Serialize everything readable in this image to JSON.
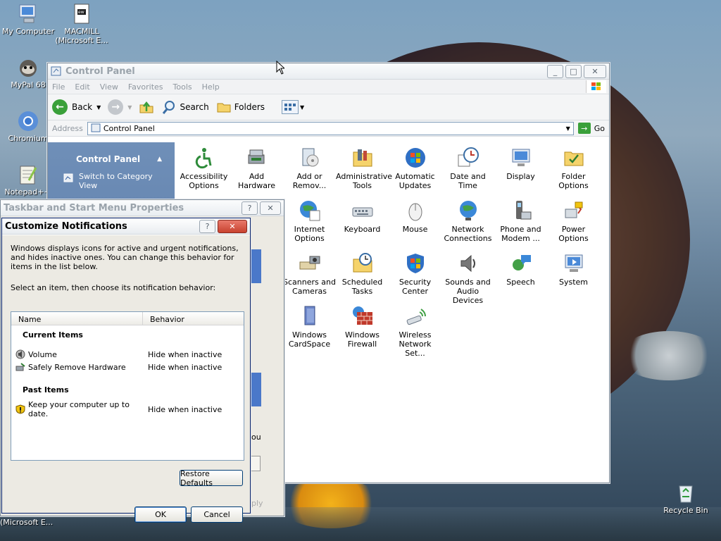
{
  "desktop": {
    "icons": [
      {
        "label": "My Computer",
        "icon": "computer-icon"
      },
      {
        "label": "MACMILL (Microsoft E...",
        "icon": "document-icon"
      },
      {
        "label": "MyPal 68",
        "icon": "raccoon-icon"
      },
      {
        "label": "Chromium",
        "icon": "chromium-icon"
      },
      {
        "label": "Notepad++",
        "icon": "notepad-icon"
      },
      {
        "label": "Recycle Bin",
        "icon": "recycle-bin-icon"
      },
      {
        "label": "(Microsoft E...",
        "icon": ""
      }
    ]
  },
  "control_panel": {
    "title": "Control Panel",
    "menu": [
      "File",
      "Edit",
      "View",
      "Favorites",
      "Tools",
      "Help"
    ],
    "toolbar": {
      "back": "Back",
      "search": "Search",
      "folders": "Folders"
    },
    "address_label": "Address",
    "address_value": "Control Panel",
    "go_label": "Go",
    "left_header": "Control Panel",
    "switch_view": "Switch to Category View",
    "items": [
      {
        "label": "Accessibility Options",
        "icon": "accessibility-icon"
      },
      {
        "label": "Add Hardware",
        "icon": "add-hardware-icon"
      },
      {
        "label": "Add or Remov...",
        "icon": "add-remove-programs-icon"
      },
      {
        "label": "Administrative Tools",
        "icon": "admin-tools-icon"
      },
      {
        "label": "Automatic Updates",
        "icon": "windows-update-icon"
      },
      {
        "label": "Date and Time",
        "icon": "clock-icon"
      },
      {
        "label": "Display",
        "icon": "display-icon"
      },
      {
        "label": "Folder Options",
        "icon": "folder-options-icon"
      },
      {
        "label": "Internet Options",
        "icon": "internet-icon"
      },
      {
        "label": "Keyboard",
        "icon": "keyboard-icon"
      },
      {
        "label": "Mouse",
        "icon": "mouse-icon"
      },
      {
        "label": "Network Connections",
        "icon": "network-icon"
      },
      {
        "label": "Phone and Modem ...",
        "icon": "phone-icon"
      },
      {
        "label": "Power Options",
        "icon": "power-icon"
      },
      {
        "label": "Scanners and Cameras",
        "icon": "scanner-icon"
      },
      {
        "label": "Scheduled Tasks",
        "icon": "scheduled-tasks-icon"
      },
      {
        "label": "Security Center",
        "icon": "shield-icon"
      },
      {
        "label": "Sounds and Audio Devices",
        "icon": "speaker-icon"
      },
      {
        "label": "Speech",
        "icon": "speech-icon"
      },
      {
        "label": "System",
        "icon": "system-icon"
      },
      {
        "label": "Windows CardSpace",
        "icon": "cardspace-icon"
      },
      {
        "label": "Windows Firewall",
        "icon": "firewall-icon"
      },
      {
        "label": "Wireless Network Set...",
        "icon": "wireless-icon"
      }
    ]
  },
  "taskbar_props": {
    "title": "Taskbar and Start Menu Properties",
    "peek_ou": "ou",
    "peek_apply": "ply"
  },
  "notifications": {
    "title": "Customize Notifications",
    "intro": "Windows displays icons for active and urgent notifications, and hides inactive ones. You can change this behavior for items in the list below.",
    "instruction": "Select an item, then choose its notification behavior:",
    "col_name": "Name",
    "col_behavior": "Behavior",
    "current_header": "Current Items",
    "past_header": "Past Items",
    "current": [
      {
        "name": "Volume",
        "behavior": "Hide when inactive",
        "icon": "volume-icon"
      },
      {
        "name": "Safely Remove Hardware",
        "behavior": "Hide when inactive",
        "icon": "safely-remove-icon"
      }
    ],
    "past": [
      {
        "name": "Keep your computer up to date.",
        "behavior": "Hide when inactive",
        "icon": "update-shield-icon"
      }
    ],
    "restore_defaults": "Restore Defaults",
    "ok": "OK",
    "cancel": "Cancel"
  }
}
